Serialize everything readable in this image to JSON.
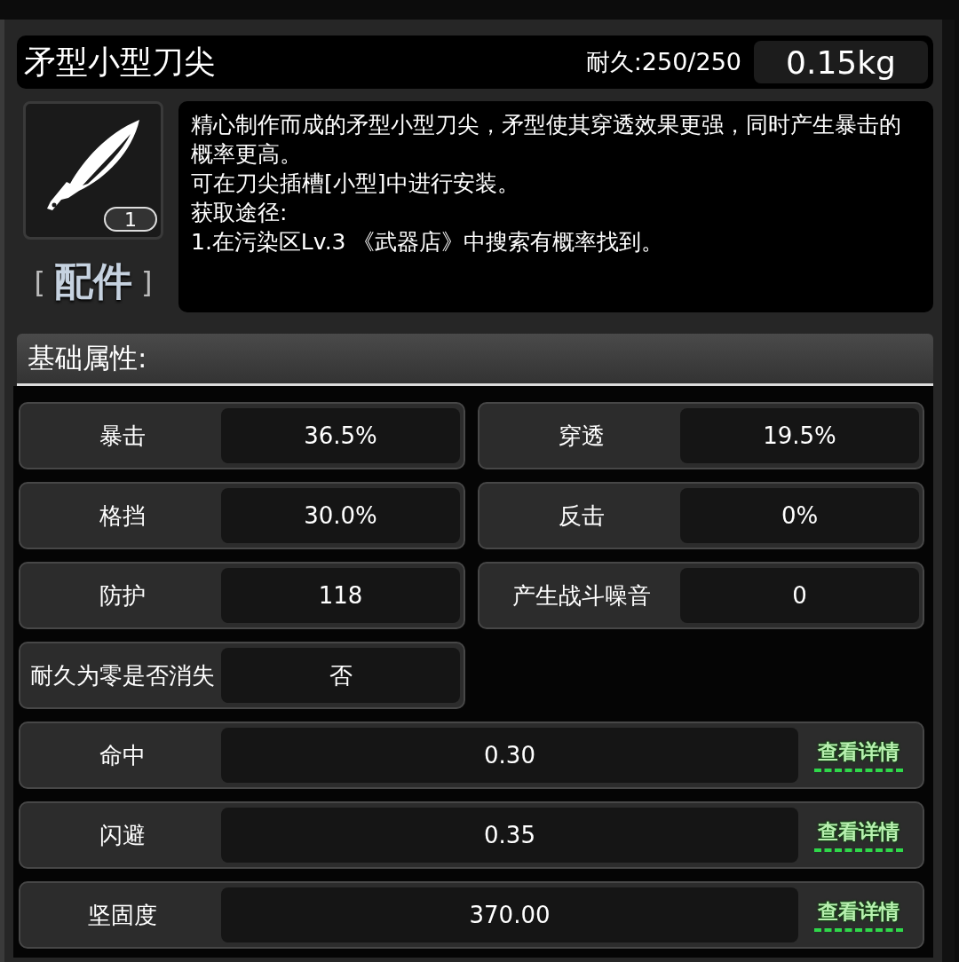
{
  "item": {
    "name": "矛型小型刀尖",
    "durability": "耐久:250/250",
    "weight": "0.15kg",
    "count": "1",
    "category": "配件",
    "category_brackets": [
      "[",
      "]"
    ],
    "description": [
      "精心制作而成的矛型小型刀尖，矛型使其穿透效果更强，同时产生暴击的概率更高。",
      "可在刀尖插槽[小型]中进行安装。",
      "获取途径:",
      "1.在污染区Lv.3 《武器店》中搜索有概率找到。"
    ]
  },
  "section_title": "基础属性:",
  "attributes": [
    {
      "label": "暴击",
      "value": "36.5%"
    },
    {
      "label": "穿透",
      "value": "19.5%"
    },
    {
      "label": "格挡",
      "value": "30.0%"
    },
    {
      "label": "反击",
      "value": "0%"
    },
    {
      "label": "防护",
      "value": "118"
    },
    {
      "label": "产生战斗噪音",
      "value": "0"
    },
    {
      "label": "耐久为零是否消失",
      "value": "否"
    }
  ],
  "detailed_attributes": [
    {
      "label": "命中",
      "value": "0.30",
      "link": "查看详情"
    },
    {
      "label": "闪避",
      "value": "0.35",
      "link": "查看详情"
    },
    {
      "label": "坚固度",
      "value": "370.00",
      "link": "查看详情"
    }
  ]
}
